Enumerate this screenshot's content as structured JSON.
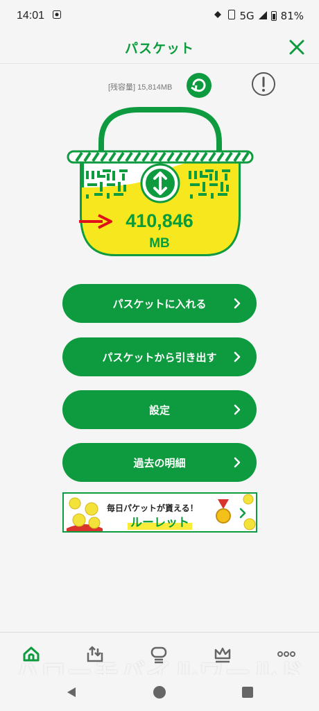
{
  "status_bar": {
    "time": "14:01",
    "network": "5G",
    "battery": "81%"
  },
  "header": {
    "title": "パスケット",
    "close_icon": "close-icon"
  },
  "remaining": {
    "label": "[残容量] 15,814MB"
  },
  "basket": {
    "value": "410,846",
    "unit": "MB",
    "colors": {
      "green": "#0e9b3f",
      "yellow": "#f6e71e"
    }
  },
  "menu": {
    "deposit": "パスケットに入れる",
    "withdraw": "パスケットから引き出す",
    "settings": "設定",
    "history": "過去の明細"
  },
  "banner": {
    "line1": "毎日パケットが貰える！",
    "line2": "ルーレット"
  },
  "bottom_nav": {
    "items": [
      "home-icon",
      "upload-tray-icon",
      "chat-icon",
      "crown-icon",
      "more-icon"
    ]
  },
  "watermark": "ハローモバイルワールド"
}
